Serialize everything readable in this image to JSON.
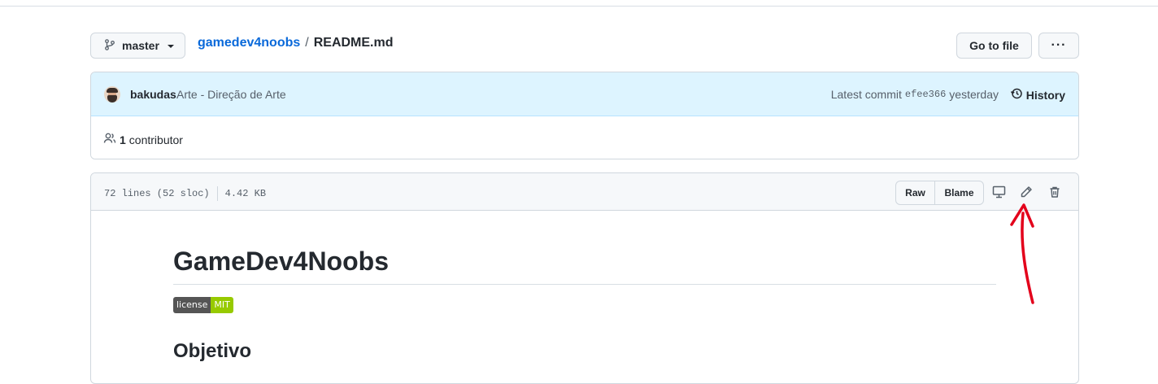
{
  "branch": {
    "label": "master",
    "icon": "git-branch-icon"
  },
  "breadcrumb": {
    "repo": "gamedev4noobs",
    "separator": "/",
    "file": "README.md"
  },
  "toolbar": {
    "goto_label": "Go to file",
    "more_label": "···"
  },
  "commit": {
    "author": "bakudas",
    "message": "Arte - Direção de Arte",
    "latest_prefix": "Latest commit",
    "sha": "efee366",
    "time": "yesterday",
    "history_label": "History"
  },
  "contributors": {
    "count": "1",
    "label": "contributor"
  },
  "file_header": {
    "lines": "72 lines (52 sloc)",
    "size": "4.42 KB",
    "raw_label": "Raw",
    "blame_label": "Blame"
  },
  "readme": {
    "title": "GameDev4Noobs",
    "badge_left": "license",
    "badge_right": "MIT",
    "section_heading": "Objetivo"
  },
  "colors": {
    "link": "#0969da",
    "commit_bg": "#ddf4ff",
    "badge_green": "#97ca00",
    "annotation_red": "#e3001b"
  }
}
